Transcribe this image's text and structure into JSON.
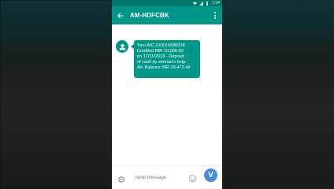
{
  "status_bar": {
    "time": "1:54"
  },
  "app_bar": {
    "title": "AM-HDFCBK"
  },
  "message": {
    "lines": [
      "Your A/C XXXXX580018",
      "Credited INR 10,000.00",
      "on 17/11/2018 - Deposit",
      "of cash by woman's help.",
      "A/c Balance INR 24,472.49"
    ]
  },
  "compose": {
    "placeholder": "Send message",
    "send_label": "V"
  },
  "colors": {
    "primary": "#009688",
    "primary_dark": "#00796b",
    "send": "#4a8ad8"
  },
  "icons": {
    "back": "back-arrow-icon",
    "menu": "overflow-menu-icon",
    "avatar": "person-icon",
    "attach": "attach-icon",
    "emoji": "emoji-icon"
  }
}
